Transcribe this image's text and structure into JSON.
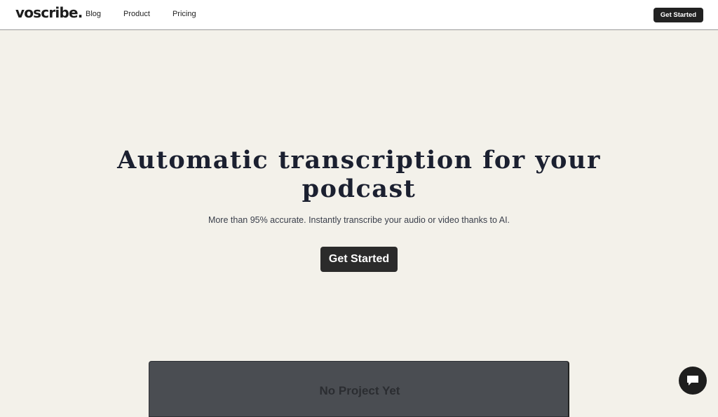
{
  "header": {
    "logo": "voscribe.",
    "nav": [
      {
        "label": "Blog"
      },
      {
        "label": "Product"
      },
      {
        "label": "Pricing"
      }
    ],
    "cta_label": "Get Started"
  },
  "hero": {
    "title_line1": "Automatic transcription for your",
    "title_line2": "podcast",
    "subtitle": "More than 95% accurate. Instantly transcribe your audio or video thanks to AI.",
    "cta_label": "Get Started"
  },
  "panel": {
    "empty_label": "No Project Yet"
  },
  "chat": {
    "icon": "chat-icon"
  },
  "colors": {
    "background": "#f3f1ea",
    "button": "#222222",
    "panel": "#4a4d52"
  }
}
